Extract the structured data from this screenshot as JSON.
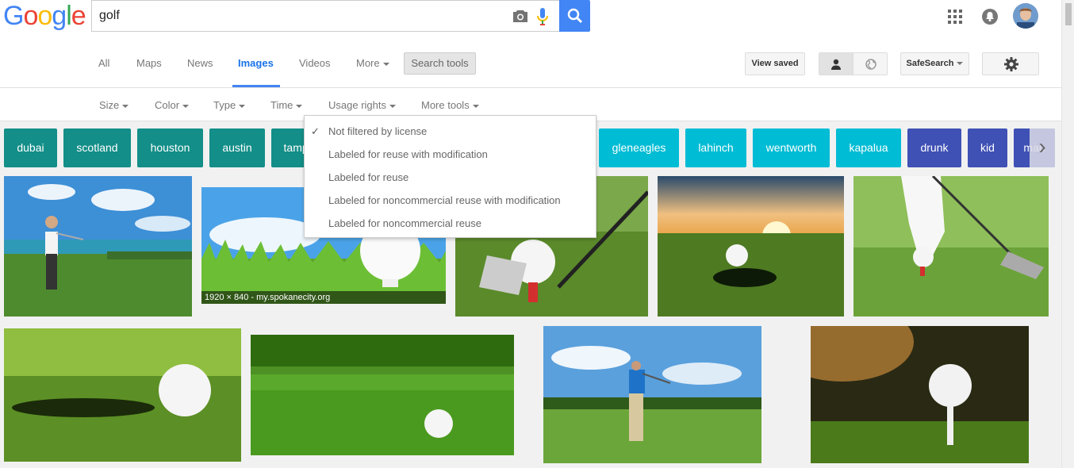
{
  "logo": {
    "letters": [
      "G",
      "o",
      "o",
      "g",
      "l",
      "e"
    ],
    "colors": [
      "#4285f4",
      "#ea4335",
      "#fbbc05",
      "#4285f4",
      "#34a853",
      "#ea4335"
    ]
  },
  "search": {
    "query": "golf"
  },
  "nav": {
    "tabs": [
      {
        "label": "All"
      },
      {
        "label": "Maps"
      },
      {
        "label": "News"
      },
      {
        "label": "Images",
        "active": true
      },
      {
        "label": "Videos"
      },
      {
        "label": "More"
      }
    ],
    "search_tools": "Search tools",
    "view_saved": "View saved",
    "safesearch": "SafeSearch"
  },
  "tools": [
    "Size",
    "Color",
    "Type",
    "Time",
    "Usage rights",
    "More tools"
  ],
  "chips": [
    {
      "label": "dubai",
      "style": "teal"
    },
    {
      "label": "scotland",
      "style": "teal"
    },
    {
      "label": "houston",
      "style": "teal"
    },
    {
      "label": "austin",
      "style": "teal"
    },
    {
      "label": "tampa",
      "style": "teal"
    },
    {
      "label": "gleneagles",
      "style": "cyan"
    },
    {
      "label": "lahinch",
      "style": "cyan"
    },
    {
      "label": "wentworth",
      "style": "cyan"
    },
    {
      "label": "kapalua",
      "style": "cyan"
    },
    {
      "label": "drunk",
      "style": "indigo"
    },
    {
      "label": "kid",
      "style": "indigo"
    },
    {
      "label": "man",
      "style": "indigo"
    }
  ],
  "usage_menu": {
    "items": [
      {
        "label": "Not filtered by license",
        "checked": true
      },
      {
        "label": "Labeled for reuse with modification"
      },
      {
        "label": "Labeled for reuse"
      },
      {
        "label": "Labeled for noncommercial reuse with modification"
      },
      {
        "label": "Labeled for noncommercial reuse"
      }
    ]
  },
  "images": [
    {
      "name": "golfer-seaside"
    },
    {
      "name": "ball-on-tee-sky",
      "caption": "1920 × 840 - my.spokanecity.org"
    },
    {
      "name": "club-and-ball"
    },
    {
      "name": "ball-at-hole-sunset"
    },
    {
      "name": "gloved-hand-placing-ball"
    },
    {
      "name": "ball-near-hole"
    },
    {
      "name": "ball-on-green"
    },
    {
      "name": "golfer-swing-course"
    },
    {
      "name": "ball-on-tee-dusk"
    }
  ]
}
